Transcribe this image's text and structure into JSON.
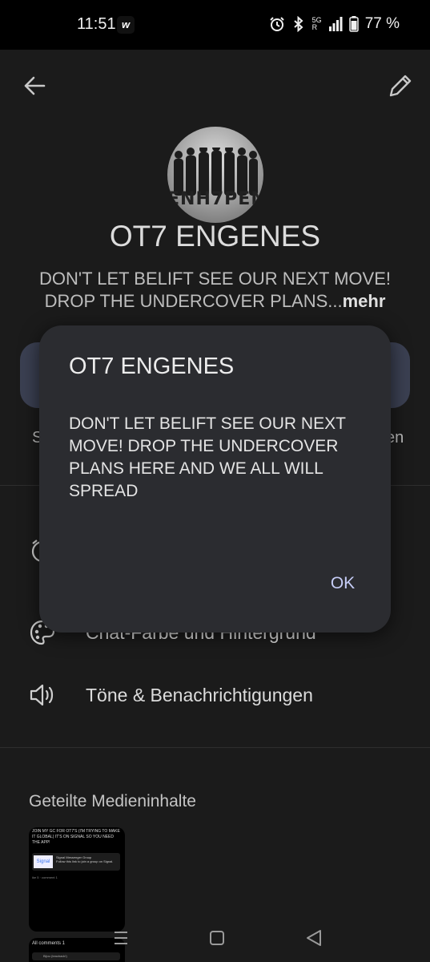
{
  "status_bar": {
    "time": "11:51",
    "app_icon": "w",
    "network_5g": "5G",
    "roaming": "R",
    "battery": "77 %"
  },
  "group": {
    "avatar_text": "ENH7PEN",
    "name": "OT7 ENGENES",
    "description_preview": "DON'T LET BELIFT SEE OUR NEXT MOVE! DROP THE UNDERCOVER PLANS...",
    "more_label": "mehr"
  },
  "edge_text": {
    "left": "S",
    "right": "en"
  },
  "settings": {
    "row_chat_color_label": "Chat-Farbe und Hintergrund",
    "row_sounds_label": "Töne & Benachrichtigungen"
  },
  "media": {
    "section_title": "Geteilte Medieninhalte",
    "thumb1_text": "JOIN MY GC FOR OT7'S (I'M TRYING TO MAKE IT GLOBAL) IT'S ON SIGNAL SO YOU NEED THE APP!",
    "thumb1_card_logo": "Signal",
    "thumb1_card_title": "Signal Messenger Group",
    "thumb1_card_sub": "Follow this link to join a group on Signal.",
    "thumb1_meta": "ike 5 · comment 1",
    "thumb2_header": "All comments 1",
    "thumb2_comment": "Bijou (teacback!)"
  },
  "dialog": {
    "title": "OT7 ENGENES",
    "body": "DON'T LET BELIFT SEE OUR NEXT MOVE! DROP THE UNDERCOVER PLANS HERE AND WE ALL WILL SPREAD",
    "ok_label": "OK"
  },
  "colors": {
    "dialog_bg": "#2b2c30",
    "accent": "#c6cdf6",
    "pill": "#3b4052"
  }
}
